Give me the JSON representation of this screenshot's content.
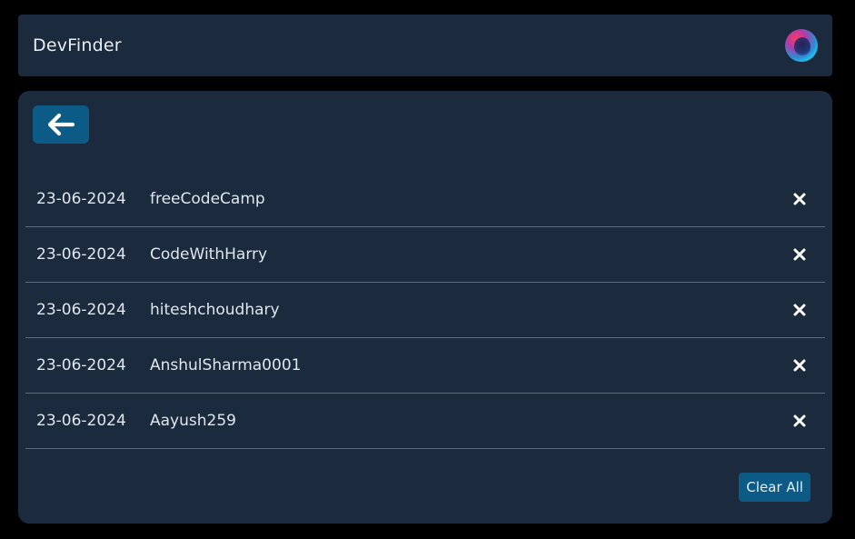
{
  "header": {
    "brand": "DevFinder",
    "avatar_icon": "user-avatar"
  },
  "toolbar": {
    "back_icon": "arrow-left-icon"
  },
  "history": [
    {
      "date": "23-06-2024",
      "name": "freeCodeCamp"
    },
    {
      "date": "23-06-2024",
      "name": "CodeWithHarry"
    },
    {
      "date": "23-06-2024",
      "name": "hiteshchoudhary"
    },
    {
      "date": "23-06-2024",
      "name": "AnshulSharma0001"
    },
    {
      "date": "23-06-2024",
      "name": "Aayush259"
    }
  ],
  "actions": {
    "clear_all_label": "Clear All",
    "remove_icon": "close-icon"
  },
  "colors": {
    "background": "#000000",
    "surface": "#1b2a3d",
    "accent": "#0c5b86",
    "divider": "#5d6b7b"
  }
}
